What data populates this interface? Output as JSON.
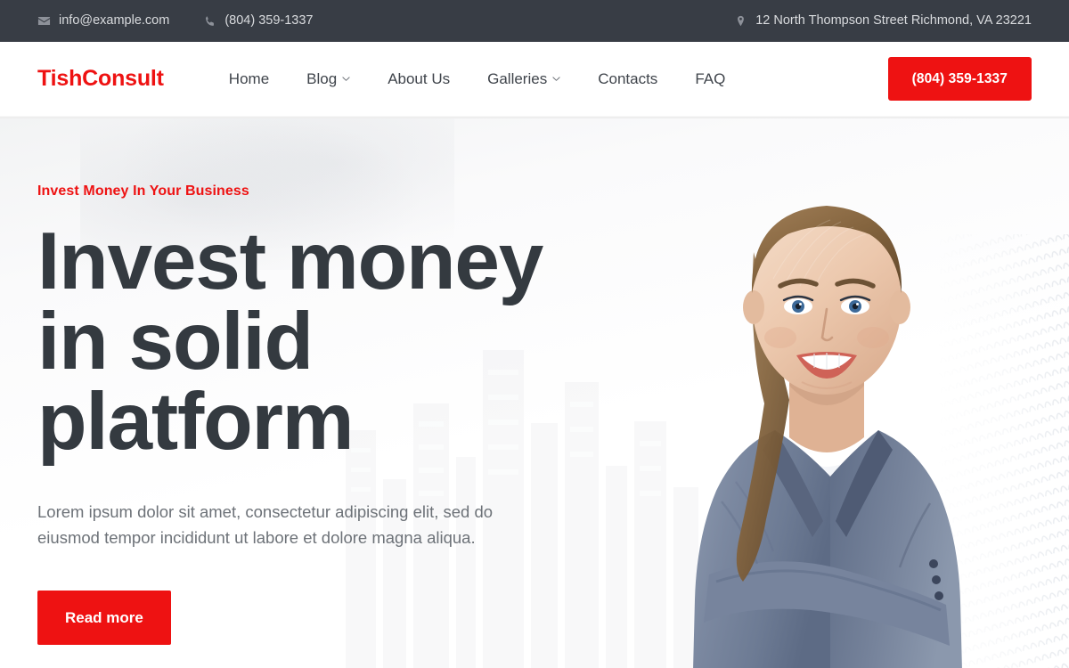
{
  "topbar": {
    "email": "info@example.com",
    "email_icon": "envelope-icon",
    "phone": "(804) 359-1337",
    "phone_icon": "phone-icon",
    "address": "12 North Thompson Street Richmond, VA 23221",
    "address_icon": "map-pin-icon",
    "background_color": "#383d45",
    "text_color": "#d9dbde"
  },
  "navbar": {
    "brand": "TishConsult",
    "brand_color": "#ee1212",
    "links": [
      {
        "label": "Home",
        "has_dropdown": false
      },
      {
        "label": "Blog",
        "has_dropdown": true
      },
      {
        "label": "About Us",
        "has_dropdown": false
      },
      {
        "label": "Galleries",
        "has_dropdown": true
      },
      {
        "label": "Contacts",
        "has_dropdown": false
      },
      {
        "label": "FAQ",
        "has_dropdown": false
      }
    ],
    "cta_label": "(804) 359-1337",
    "cta_color": "#ee1212"
  },
  "hero": {
    "eyebrow": "Invest Money In Your Business",
    "eyebrow_color": "#ee1212",
    "title": "Invest money in solid platform",
    "title_color": "#343a40",
    "paragraph": "Lorem ipsum dolor sit amet, consectetur adipiscing elit, sed do eiusmod tempor incididunt ut labore et dolore magna aliqua.",
    "button_label": "Read more",
    "button_color": "#ee1212",
    "image_alt": "smiling businesswoman in gray blazer with arms crossed"
  }
}
